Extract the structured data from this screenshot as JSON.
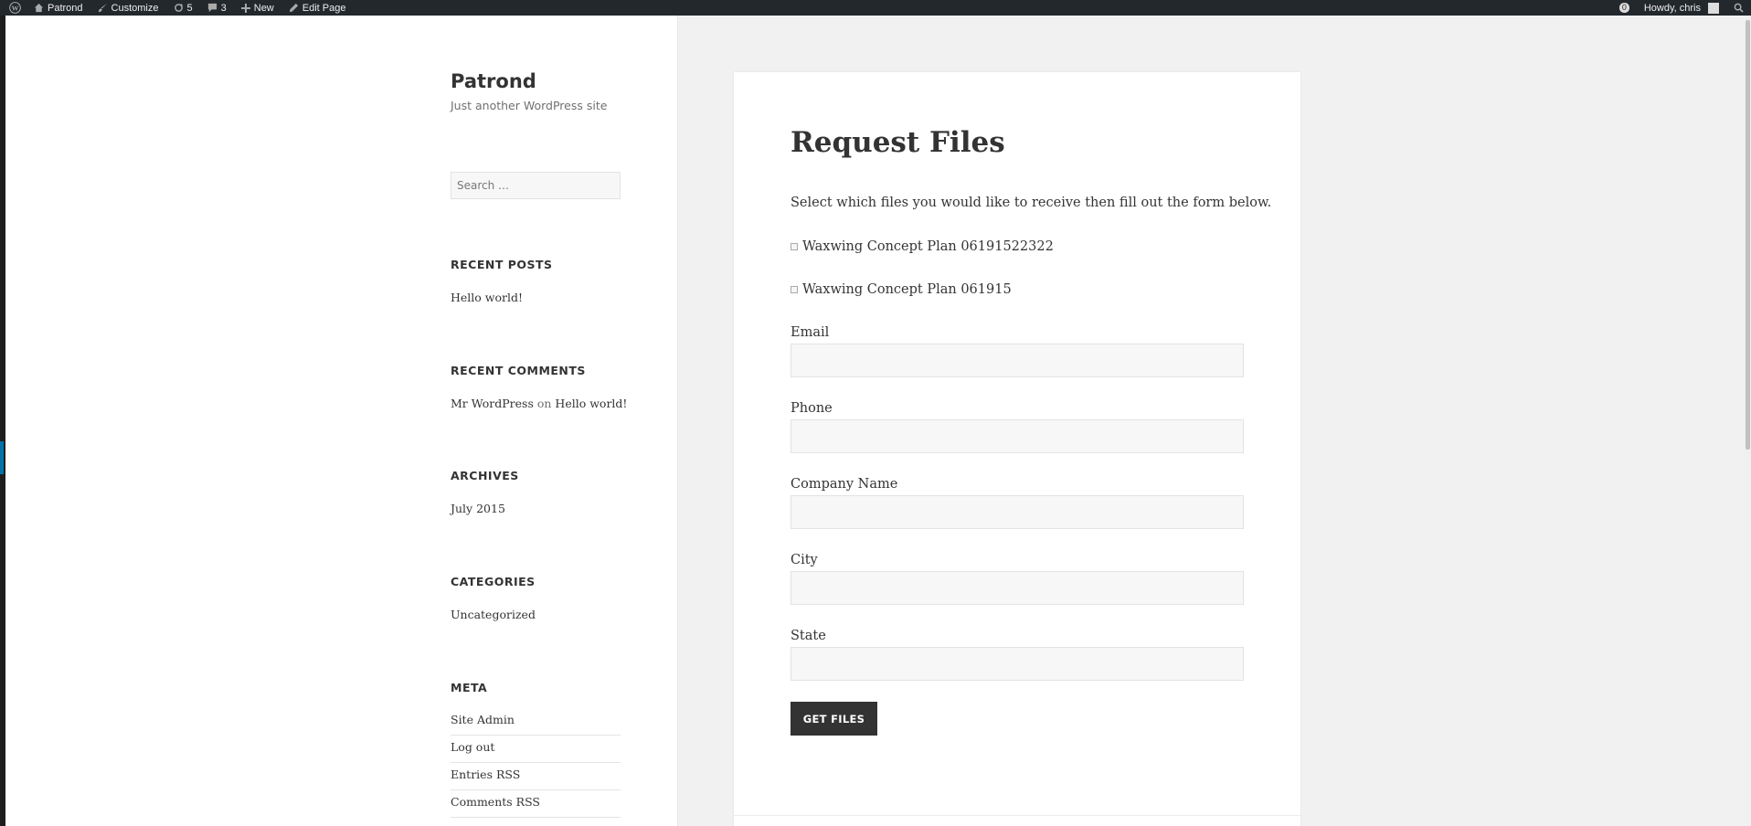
{
  "adminbar": {
    "site_name": "Patrond",
    "customize": "Customize",
    "updates_count": "5",
    "comments_count": "3",
    "new_label": "New",
    "edit_page": "Edit Page",
    "notifications_count": "0",
    "howdy": "Howdy, chris"
  },
  "sidebar": {
    "site_title": "Patrond",
    "site_description": "Just another WordPress site",
    "search_placeholder": "Search …",
    "recent_posts": {
      "title": "RECENT POSTS",
      "items": [
        "Hello world!"
      ]
    },
    "recent_comments": {
      "title": "RECENT COMMENTS",
      "author": "Mr WordPress",
      "connector": "on",
      "post": "Hello world!"
    },
    "archives": {
      "title": "ARCHIVES",
      "items": [
        "July 2015"
      ]
    },
    "categories": {
      "title": "CATEGORIES",
      "items": [
        "Uncategorized"
      ]
    },
    "meta": {
      "title": "META",
      "items": [
        "Site Admin",
        "Log out",
        "Entries RSS",
        "Comments RSS"
      ]
    }
  },
  "main": {
    "title": "Request Files",
    "intro": "Select which files you would like to receive then fill out the form below.",
    "files": [
      "Waxwing Concept Plan 06191522322",
      "Waxwing Concept Plan 061915"
    ],
    "fields": [
      "Email",
      "Phone",
      "Company Name",
      "City",
      "State"
    ],
    "submit_label": "GET FILES"
  }
}
